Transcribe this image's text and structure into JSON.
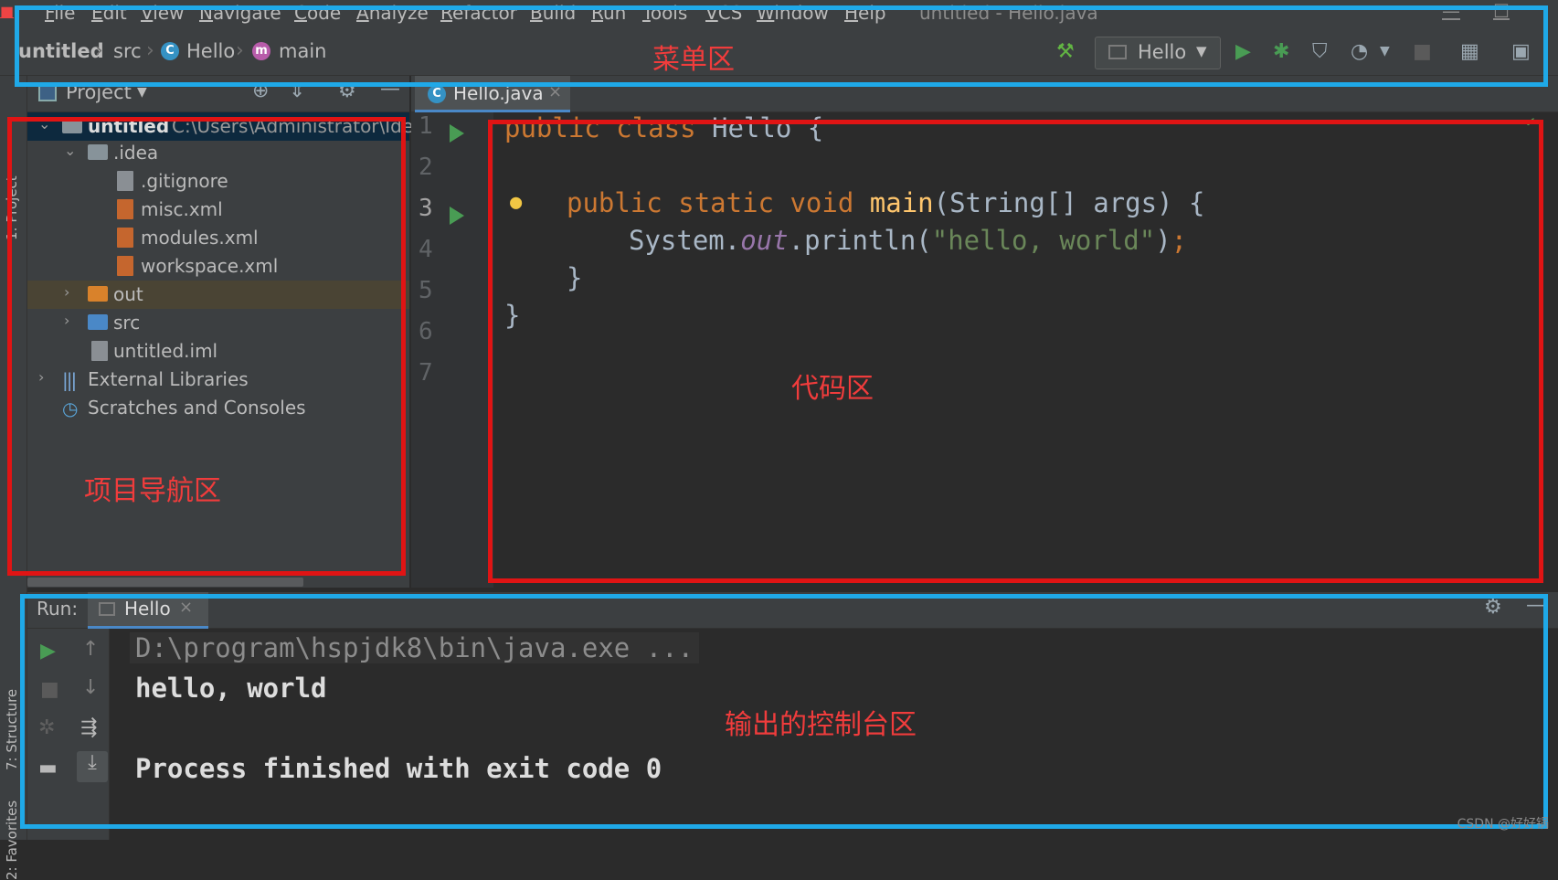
{
  "menubar": {
    "items": [
      "File",
      "Edit",
      "View",
      "Navigate",
      "Code",
      "Analyze",
      "Refactor",
      "Build",
      "Run",
      "Tools",
      "VCS",
      "Window",
      "Help"
    ],
    "window_title": "untitled - Hello.java"
  },
  "navbar": {
    "breadcrumbs": [
      "untitled",
      "src",
      "Hello",
      "main"
    ],
    "run_config": "Hello"
  },
  "left_strip": {
    "tabs": [
      "1: Project",
      "7: Structure",
      "2: Favorites"
    ]
  },
  "project": {
    "header": "Project",
    "root_label": "untitled",
    "root_path": "C:\\Users\\Administrator\\Ide",
    "tree": [
      {
        "label": ".idea"
      },
      {
        "label": ".gitignore"
      },
      {
        "label": "misc.xml"
      },
      {
        "label": "modules.xml"
      },
      {
        "label": "workspace.xml"
      },
      {
        "label": "out"
      },
      {
        "label": "src"
      },
      {
        "label": "untitled.iml"
      },
      {
        "label": "External Libraries"
      },
      {
        "label": "Scratches and Consoles"
      }
    ]
  },
  "editor": {
    "tab": "Hello.java",
    "line_numbers": [
      "1",
      "2",
      "3",
      "4",
      "5",
      "6",
      "7"
    ],
    "code": {
      "l1_kw1": "public",
      "l1_kw2": "class",
      "l1_name": "Hello {",
      "l3_kw1": "public",
      "l3_kw2": "static",
      "l3_kw3": "void",
      "l3_fn": "main",
      "l3_rest": "(String[] args) {",
      "l4_a": "System.",
      "l4_field": "out",
      "l4_b": ".println(",
      "l4_str": "\"hello, world\"",
      "l4_c": ")",
      "l4_semi": ";",
      "l5": "}",
      "l6": "}"
    }
  },
  "run_panel": {
    "label": "Run:",
    "tab": "Hello",
    "console": {
      "cmd": "D:\\program\\hspjdk8\\bin\\java.exe ...",
      "output": "hello, world",
      "exit": "Process finished with exit code 0"
    }
  },
  "annotations": {
    "menu": "菜单区",
    "code": "代码区",
    "nav": "项目导航区",
    "console": "输出的控制台区",
    "watermark": "CSDN @好好锅"
  },
  "colors": {
    "annotation_blue": "#1fa9e8",
    "annotation_red": "#e01414",
    "keyword": "#cc7832",
    "string": "#6a8759"
  }
}
